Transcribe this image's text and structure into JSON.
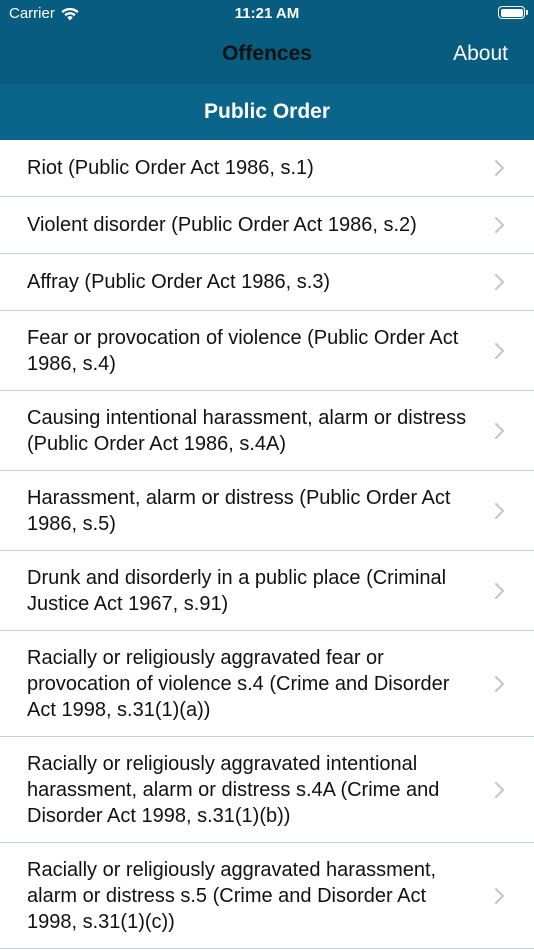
{
  "status": {
    "carrier": "Carrier",
    "time": "11:21 AM"
  },
  "nav": {
    "title": "Offences",
    "about": "About"
  },
  "section": {
    "title": "Public Order"
  },
  "colors": {
    "nav_bg": "#085c7f",
    "header_bg": "#0b6489",
    "separator": "#b9d2dc",
    "chevron": "#c4c4c9"
  },
  "items": [
    {
      "label": "Riot (Public Order Act 1986, s.1)"
    },
    {
      "label": "Violent disorder (Public Order Act 1986, s.2)"
    },
    {
      "label": "Affray (Public Order Act 1986, s.3)"
    },
    {
      "label": "Fear or provocation of violence (Public Order Act 1986, s.4)"
    },
    {
      "label": "Causing intentional harassment, alarm or distress (Public Order Act 1986, s.4A)"
    },
    {
      "label": "Harassment, alarm or distress (Public Order Act 1986, s.5)"
    },
    {
      "label": "Drunk and disorderly in a public place (Criminal Justice Act 1967, s.91)"
    },
    {
      "label": "Racially or religiously aggravated fear or provocation of violence s.4 (Crime and Disorder Act 1998, s.31(1)(a))"
    },
    {
      "label": "Racially or religiously aggravated intentional harassment, alarm or distress s.4A (Crime and Disorder Act 1998, s.31(1)(b))"
    },
    {
      "label": "Racially or religiously aggravated harassment, alarm or distress s.5 (Crime and Disorder Act 1998, s.31(1)(c))"
    }
  ]
}
